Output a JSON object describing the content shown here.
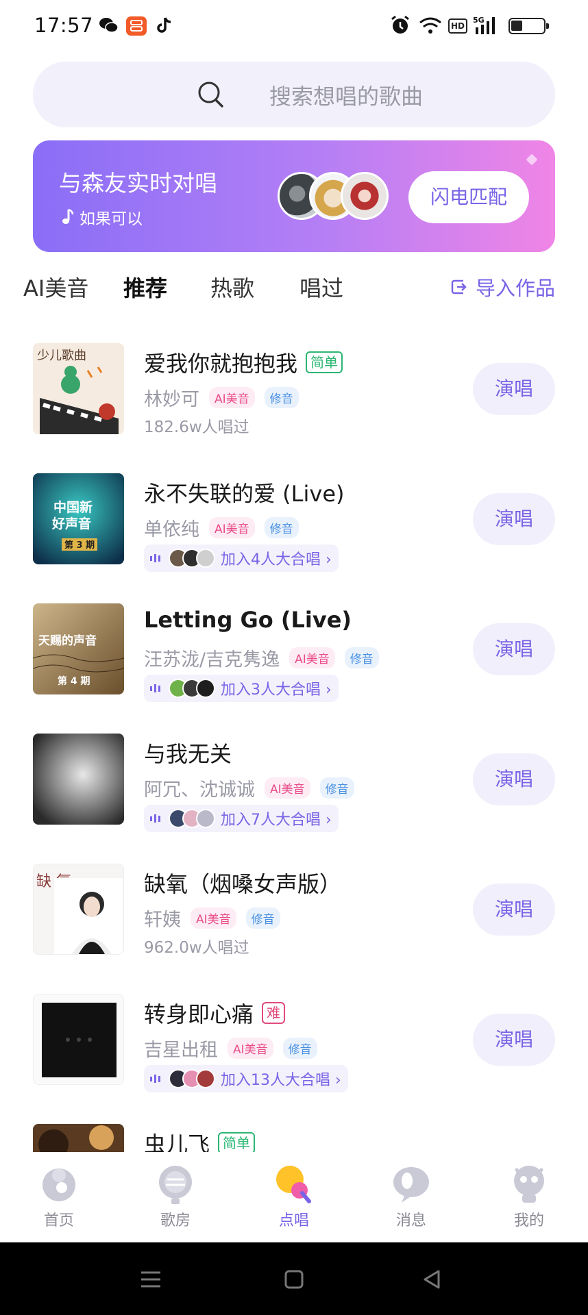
{
  "status_bar": {
    "time": "17:57",
    "icons": [
      "wechat-icon",
      "app-icon",
      "douyin-icon",
      "alarm-icon",
      "wifi-icon",
      "hd-icon",
      "5g-signal-icon",
      "battery-icon"
    ],
    "hd_label": "HD"
  },
  "search": {
    "placeholder": "搜索想唱的歌曲"
  },
  "banner": {
    "title": "与森友实时对唱",
    "subtitle": "如果可以",
    "button": "闪电匹配",
    "gradient_colors": [
      "#8a6ef7",
      "#f085e6"
    ]
  },
  "tabs": [
    {
      "label": "AI美音"
    },
    {
      "label": "推荐",
      "active": true
    },
    {
      "label": "热歌"
    },
    {
      "label": "唱过"
    }
  ],
  "import_label": "导入作品",
  "songs": [
    {
      "title": "爱我你就抱抱我",
      "level": "简单",
      "artist": "林妙可",
      "tag_ai": "AI美音",
      "tag_fix": "修音",
      "sung": "182.6w人唱过",
      "action": "演唱"
    },
    {
      "title": "永不失联的爱 (Live)",
      "artist": "单依纯",
      "tag_ai": "AI美音",
      "tag_fix": "修音",
      "chorus": "加入4人大合唱 ›",
      "action": "演唱"
    },
    {
      "title": "Letting Go (Live)",
      "artist": "汪苏泷/吉克隽逸",
      "tag_ai": "AI美音",
      "tag_fix": "修音",
      "chorus": "加入3人大合唱 ›",
      "action": "演唱"
    },
    {
      "title": "与我无关",
      "artist": "阿冗、沈诚诚",
      "tag_ai": "AI美音",
      "tag_fix": "修音",
      "chorus": "加入7人大合唱 ›",
      "action": "演唱"
    },
    {
      "title": "缺氧（烟嗓女声版）",
      "artist": "轩姨",
      "tag_ai": "AI美音",
      "tag_fix": "修音",
      "sung": "962.0w人唱过",
      "action": "演唱"
    },
    {
      "title": "转身即心痛",
      "level": "难",
      "artist": "吉星出租",
      "tag_ai": "AI美音",
      "tag_fix": "修音",
      "chorus": "加入13人大合唱 ›",
      "action": "演唱"
    },
    {
      "title": "虫儿飞",
      "level": "简单"
    }
  ],
  "cover_texts": {
    "song0": "少儿歌曲",
    "song1_a": "中国新",
    "song1_b": "好声音",
    "song1_c": "第 3 期",
    "song2_a": "天赐的声音",
    "song2_b": "第 4 期",
    "song4": "缺 氧"
  },
  "bottom_nav": [
    {
      "label": "首页",
      "icon": "home-icon"
    },
    {
      "label": "歌房",
      "icon": "ktv-room-icon"
    },
    {
      "label": "点唱",
      "icon": "sing-icon",
      "active": true
    },
    {
      "label": "消息",
      "icon": "message-icon"
    },
    {
      "label": "我的",
      "icon": "profile-icon"
    }
  ],
  "colors": {
    "accent": "#7a63e6",
    "easy": "#2bb673",
    "hard": "#e04a7a",
    "ai_tag": "#ea4c89",
    "fix_tag": "#4a90e2"
  }
}
